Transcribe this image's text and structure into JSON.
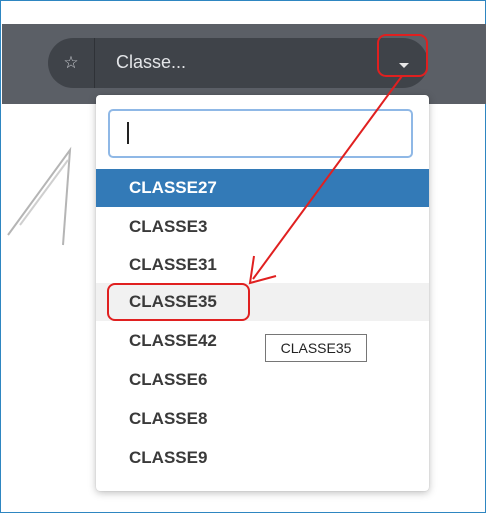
{
  "select": {
    "placeholder": "Classe...",
    "star_icon": "star-icon",
    "caret_icon": "chevron-down-icon"
  },
  "dropdown": {
    "search_value": "",
    "items": [
      {
        "label": "CLASSE27",
        "state": "highlighted"
      },
      {
        "label": "CLASSE3",
        "state": "normal"
      },
      {
        "label": "CLASSE31",
        "state": "normal"
      },
      {
        "label": "CLASSE35",
        "state": "hover"
      },
      {
        "label": "CLASSE42",
        "state": "normal"
      },
      {
        "label": "CLASSE6",
        "state": "normal"
      },
      {
        "label": "CLASSE8",
        "state": "normal"
      },
      {
        "label": "CLASSE9",
        "state": "normal"
      }
    ]
  },
  "tooltip": {
    "text": "CLASSE35"
  },
  "colors": {
    "highlight": "#337ab7",
    "annotation": "#e02020",
    "topbar": "#5b5f66"
  }
}
